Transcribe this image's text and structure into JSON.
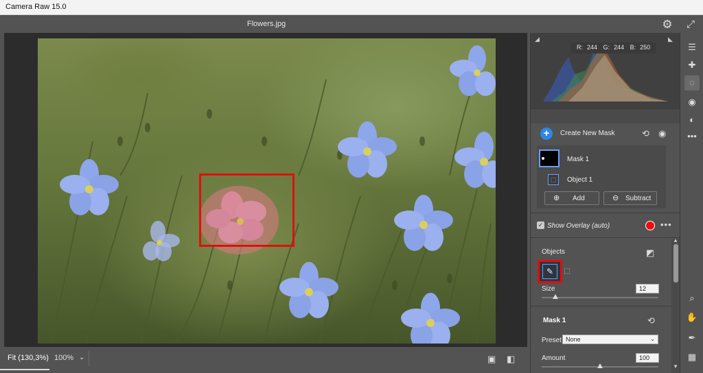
{
  "app": {
    "title": "Camera Raw 15.0"
  },
  "document": {
    "filename": "Flowers.jpg"
  },
  "histogram": {
    "r_label": "R:",
    "r": "244",
    "g_label": "G:",
    "g": "244",
    "b_label": "B:",
    "b": "250"
  },
  "masks": {
    "create_label": "Create New Mask",
    "mask_name": "Mask 1",
    "object_name": "Object 1",
    "add_label": "Add",
    "subtract_label": "Subtract",
    "show_overlay_label": "Show Overlay (auto)",
    "overlay_color": "#ea0f0f"
  },
  "objects_panel": {
    "title": "Objects",
    "size_label": "Size",
    "size_value": "12",
    "size_level": 0.12
  },
  "mask_panel": {
    "title": "Mask 1",
    "preset_label": "Preset",
    "preset_value": "None",
    "amount_label": "Amount",
    "amount_value": "100",
    "amount_level": 0.5
  },
  "footer": {
    "fit_label": "Fit (130,3%)",
    "zoom_label": "100%"
  },
  "colors": {
    "selection_highlight": "#e00f0f",
    "accent": "#2f86e3"
  }
}
